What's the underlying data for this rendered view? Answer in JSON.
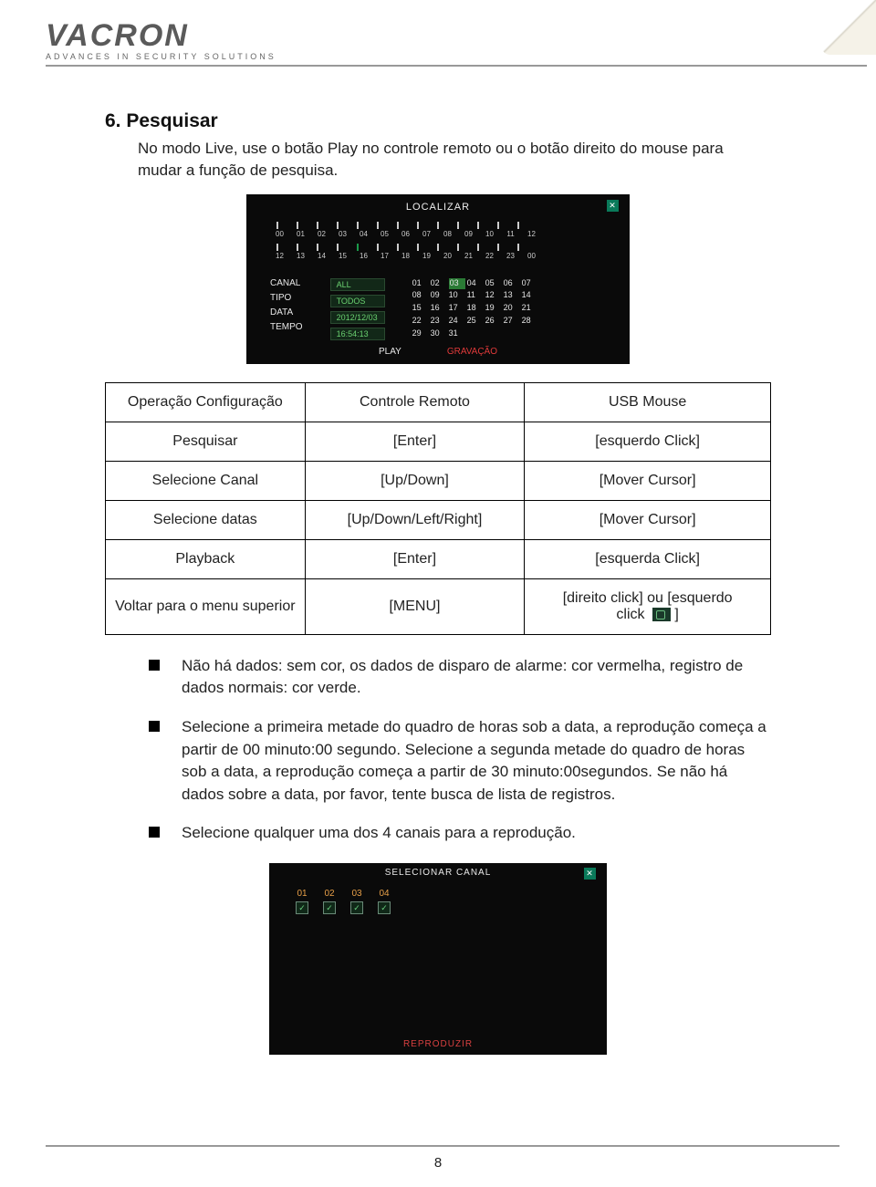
{
  "header": {
    "logo_name": "VACRON",
    "logo_subtitle": "ADVANCES IN SECURITY SOLUTIONS"
  },
  "section": {
    "title": "6. Pesquisar",
    "intro": "No modo Live, use o botão Play no controle remoto ou o botão direito do mouse para mudar a função de pesquisa."
  },
  "screenshot1": {
    "title": "LOCALIZAR",
    "timeline_top": [
      "00",
      "01",
      "02",
      "03",
      "04",
      "05",
      "06",
      "07",
      "08",
      "09",
      "10",
      "11",
      "12"
    ],
    "timeline_bot": [
      "12",
      "13",
      "14",
      "15",
      "16",
      "17",
      "18",
      "19",
      "20",
      "21",
      "22",
      "23",
      "00"
    ],
    "labels": [
      "CANAL",
      "TIPO",
      "DATA",
      "TEMPO"
    ],
    "values": [
      "ALL",
      "TODOS",
      "2012/12/03",
      "16:54:13"
    ],
    "calendar": [
      "01",
      "02",
      "03",
      "04",
      "05",
      "06",
      "07",
      "08",
      "09",
      "10",
      "11",
      "12",
      "13",
      "14",
      "15",
      "16",
      "17",
      "18",
      "19",
      "20",
      "21",
      "22",
      "23",
      "24",
      "25",
      "26",
      "27",
      "28",
      "29",
      "30",
      "31"
    ],
    "highlight_day": "03",
    "play": "PLAY",
    "record": "GRAVAÇÃO"
  },
  "table": {
    "headers": [
      "Operação Configuração",
      "Controle Remoto",
      "USB Mouse"
    ],
    "rows": [
      {
        "op": "Pesquisar",
        "remote": "[Enter]",
        "mouse": "[esquerdo Click]"
      },
      {
        "op": "Selecione Canal",
        "remote": "[Up/Down]",
        "mouse": "[Mover Cursor]"
      },
      {
        "op": "Selecione datas",
        "remote": "[Up/Down/Left/Right]",
        "mouse": "[Mover Cursor]"
      },
      {
        "op": "Playback",
        "remote": "[Enter]",
        "mouse": "[esquerda Click]"
      },
      {
        "op": "Voltar para o menu superior",
        "remote": "[MENU]",
        "mouse_pre": "[direito click] ou [esquerdo",
        "mouse_post": "click",
        "mouse_tail": "]"
      }
    ]
  },
  "bullets": [
    "Não há dados: sem cor, os dados de disparo de alarme: cor vermelha, registro de dados normais: cor verde.",
    "Selecione a primeira metade do quadro de horas sob a data, a reprodução começa a partir de 00 minuto:00 segundo. Selecione a segunda metade do quadro de horas sob a data, a reprodução começa a partir de 30 minuto:00segundos. Se não há dados sobre a data, por favor, tente busca de lista de registros.",
    "Selecione qualquer uma dos 4 canais para a reprodução."
  ],
  "screenshot2": {
    "title": "SELECIONAR CANAL",
    "channels": [
      "01",
      "02",
      "03",
      "04"
    ],
    "footer": "REPRODUZIR"
  },
  "page_number": "8"
}
